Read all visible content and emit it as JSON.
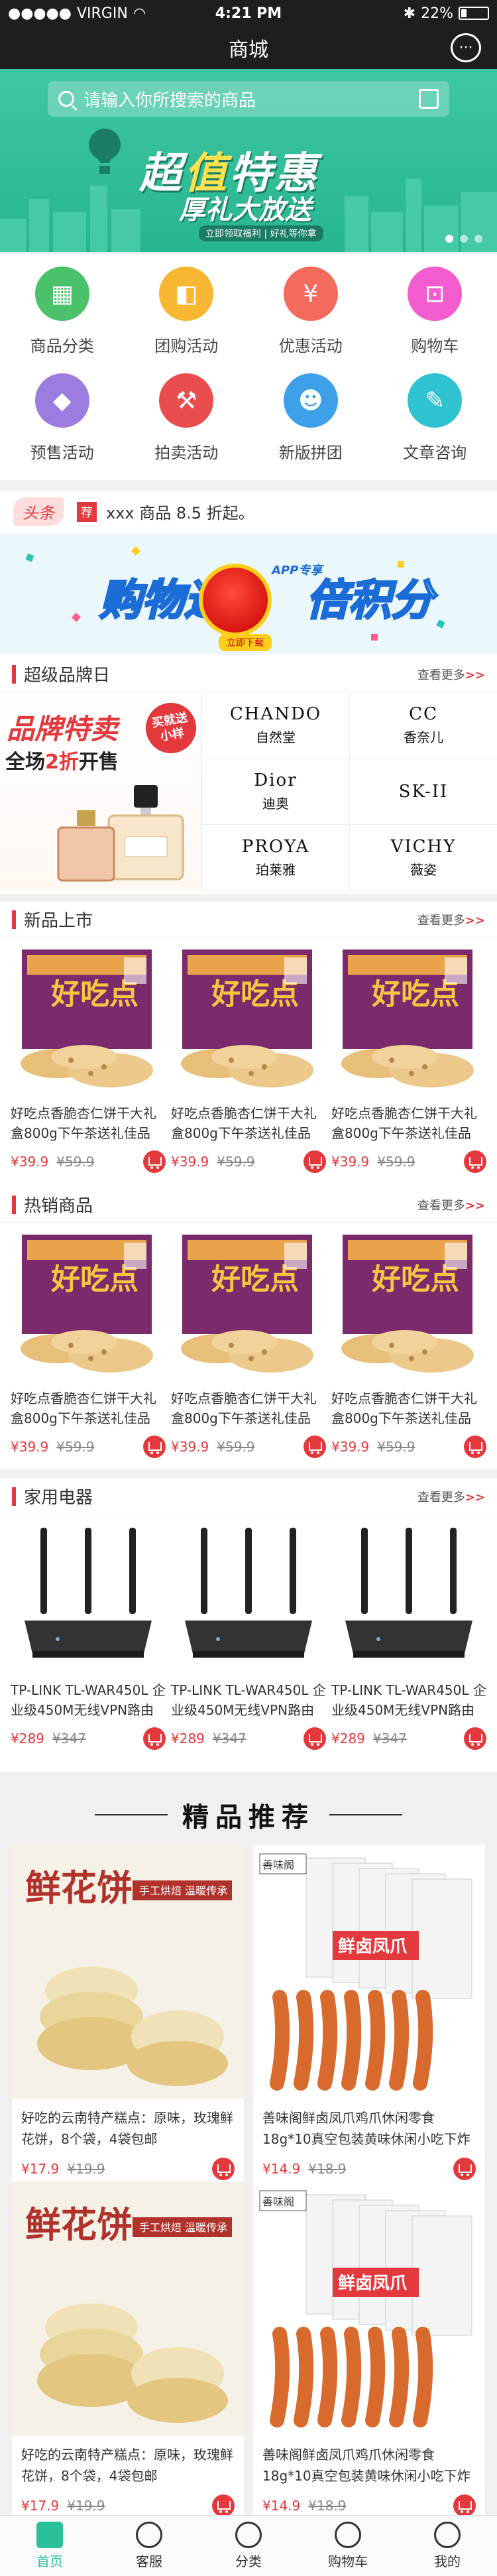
{
  "status": {
    "carrier": "VIRGIN",
    "time": "4:21 PM",
    "battery": "22%"
  },
  "nav": {
    "title": "商城"
  },
  "search": {
    "placeholder": "请输入你所搜索的商品"
  },
  "banner": {
    "title_pre": "超",
    "title_hl": "值",
    "title_post": "特惠",
    "subtitle": "厚礼大放送",
    "note": "立即领取福利 | 好礼等你拿",
    "slides": 3
  },
  "categories": [
    {
      "label": "商品分类",
      "icon": "shop-icon",
      "color": "#4cc16b"
    },
    {
      "label": "团购活动",
      "icon": "group-buy-icon",
      "color": "#f7b733"
    },
    {
      "label": "优惠活动",
      "icon": "coupon-icon",
      "color": "#f46a5c"
    },
    {
      "label": "购物车",
      "icon": "cart-icon",
      "color": "#f25ccf"
    },
    {
      "label": "预售活动",
      "icon": "presale-tag-icon",
      "color": "#9b7de0"
    },
    {
      "label": "拍卖活动",
      "icon": "auction-hammer-icon",
      "color": "#ea4d4d"
    },
    {
      "label": "新版拼团",
      "icon": "team-icon",
      "color": "#3fa0ea"
    },
    {
      "label": "文章咨询",
      "icon": "article-chat-icon",
      "color": "#2fc2d0"
    }
  ],
  "headline": {
    "tag": "头条",
    "badge": "荐",
    "text": "xxx 商品 8.5 折起。"
  },
  "promo": {
    "text_left": "购物返",
    "text_right": "倍积分",
    "app_tag": "APP专享",
    "button": "立即下载"
  },
  "brands": {
    "title": "超级品牌日",
    "more": "查看更多",
    "left_title": "品牌特卖",
    "left_sub_pre": "全场",
    "left_sub_hl": "2折",
    "left_sub_post": "开售",
    "stamp_line1": "买就送",
    "stamp_line2": "小样",
    "items": [
      {
        "en": "CHANDO",
        "cn": "自然堂"
      },
      {
        "en": "CC",
        "cn": "香奈儿"
      },
      {
        "en": "Dior",
        "cn": "迪奥"
      },
      {
        "en": "SK-II",
        "cn": ""
      },
      {
        "en": "PROYA",
        "cn": "珀莱雅"
      },
      {
        "en": "VICHY",
        "cn": "薇姿"
      }
    ]
  },
  "new_products": {
    "title": "新品上市",
    "more": "查看更多",
    "items": [
      {
        "name": "好吃点香脆杏仁饼干大礼盒800g下午茶送礼佳品",
        "price": "¥39.9",
        "old_price": "¥59.9"
      },
      {
        "name": "好吃点香脆杏仁饼干大礼盒800g下午茶送礼佳品",
        "price": "¥39.9",
        "old_price": "¥59.9"
      },
      {
        "name": "好吃点香脆杏仁饼干大礼盒800g下午茶送礼佳品",
        "price": "¥39.9",
        "old_price": "¥59.9"
      }
    ]
  },
  "hot_products": {
    "title": "热销商品",
    "more": "查看更多",
    "items": [
      {
        "name": "好吃点香脆杏仁饼干大礼盒800g下午茶送礼佳品",
        "price": "¥39.9",
        "old_price": "¥59.9"
      },
      {
        "name": "好吃点香脆杏仁饼干大礼盒800g下午茶送礼佳品",
        "price": "¥39.9",
        "old_price": "¥59.9"
      },
      {
        "name": "好吃点香脆杏仁饼干大礼盒800g下午茶送礼佳品",
        "price": "¥39.9",
        "old_price": "¥59.9"
      }
    ]
  },
  "appliances": {
    "title": "家用电器",
    "more": "查看更多",
    "items": [
      {
        "name": "TP-LINK TL-WAR450L 企业级450M无线VPN路由器千兆端口 家用",
        "price": "¥289",
        "old_price": "¥347"
      },
      {
        "name": "TP-LINK TL-WAR450L 企业级450M无线VPN路由器千兆端口 家用",
        "price": "¥289",
        "old_price": "¥347"
      },
      {
        "name": "TP-LINK TL-WAR450L 企业级450M无线VPN路由器千兆端口 家用",
        "price": "¥289",
        "old_price": "¥347"
      }
    ]
  },
  "featured": {
    "title": "精品推荐",
    "pastry_label": "鲜花饼",
    "pastry_tag": "手工烘焙 温暖传承",
    "snack_brand": "善味阁",
    "snack_label": "鲜卤凤爪",
    "items": [
      {
        "name": "好吃的云南特产糕点：原味，玫瑰鲜花饼，8个袋，4袋包邮",
        "price": "¥17.9",
        "old_price": "¥19.9",
        "kind": "pastry"
      },
      {
        "name": "善味阁鲜卤凤爪鸡爪休闲零食18g*10真空包装黄味休闲小吃下炸熟和啤酒",
        "price": "¥14.9",
        "old_price": "¥18.9",
        "kind": "snack"
      },
      {
        "name": "好吃的云南特产糕点：原味，玫瑰鲜花饼，8个袋，4袋包邮",
        "price": "¥17.9",
        "old_price": "¥19.9",
        "kind": "pastry"
      },
      {
        "name": "善味阁鲜卤凤爪鸡爪休闲零食18g*10真空包装黄味休闲小吃下炸熟和啤酒",
        "price": "¥14.9",
        "old_price": "¥18.9",
        "kind": "snack"
      }
    ]
  },
  "tabbar": [
    {
      "label": "首页",
      "icon": "home-icon",
      "active": true
    },
    {
      "label": "客服",
      "icon": "chat-icon",
      "active": false
    },
    {
      "label": "分类",
      "icon": "category-icon",
      "active": false
    },
    {
      "label": "购物车",
      "icon": "cart-icon",
      "active": false
    },
    {
      "label": "我的",
      "icon": "profile-icon",
      "active": false
    }
  ]
}
